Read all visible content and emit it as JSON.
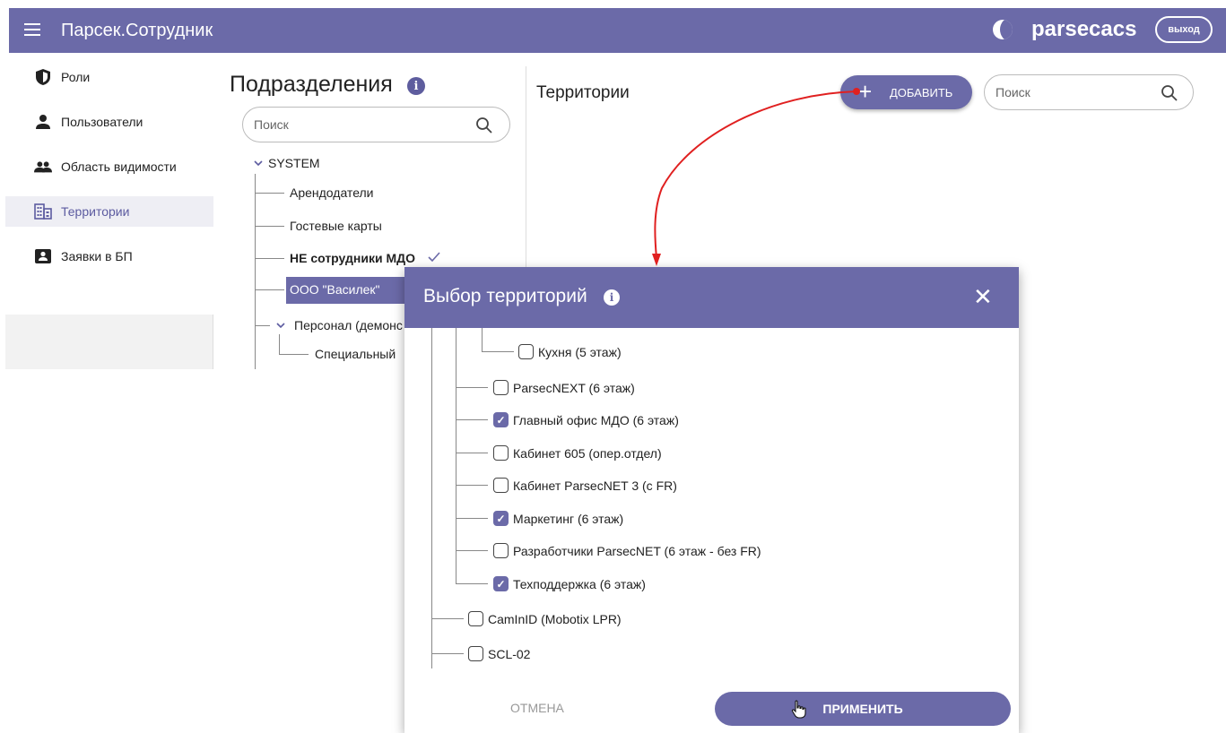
{
  "header": {
    "app_title": "Парсек.Сотрудник",
    "brand": "parsecacs",
    "logout_label": "выход"
  },
  "sidebar": {
    "items": [
      {
        "label": "Роли",
        "icon": "shield-icon"
      },
      {
        "label": "Пользователи",
        "icon": "user-icon"
      },
      {
        "label": "Область видимости",
        "icon": "users-group-icon"
      },
      {
        "label": "Территории",
        "icon": "building-icon",
        "active": true
      },
      {
        "label": "Заявки в БП",
        "icon": "badge-icon"
      }
    ]
  },
  "subdivisions": {
    "title": "Подразделения",
    "search_placeholder": "Поиск",
    "tree": {
      "root": "SYSTEM",
      "children": [
        "Арендодатели",
        "Гостевые карты",
        "НЕ сотрудники МДО",
        "ООО \"Василек\"",
        "Персонал (демонс",
        "Специальный"
      ]
    }
  },
  "territories": {
    "title": "Территории",
    "add_label": "ДОБАВИТЬ",
    "search_placeholder": "Поиск"
  },
  "modal": {
    "title": "Выбор территорий",
    "close_label": "✕",
    "items": [
      {
        "label": "Кухня (5 этаж)",
        "checked": false
      },
      {
        "label": "ParsecNEXT (6 этаж)",
        "checked": false
      },
      {
        "label": "Главный офис МДО (6 этаж)",
        "checked": true
      },
      {
        "label": "Кабинет 605 (опер.отдел)",
        "checked": false
      },
      {
        "label": "Кабинет ParsecNET 3 (с FR)",
        "checked": false
      },
      {
        "label": "Маркетинг (6 этаж)",
        "checked": true
      },
      {
        "label": "Разработчики ParsecNET (6 этаж - без FR)",
        "checked": false
      },
      {
        "label": "Техподдержка (6 этаж)",
        "checked": true
      },
      {
        "label": "CamInID (Mobotix LPR)",
        "checked": false
      },
      {
        "label": "SCL-02",
        "checked": false
      }
    ],
    "cancel_label": "ОТМЕНА",
    "apply_label": "ПРИМЕНИТЬ"
  },
  "colors": {
    "primary": "#6b6aa8",
    "annotation_arrow": "#e02020"
  }
}
